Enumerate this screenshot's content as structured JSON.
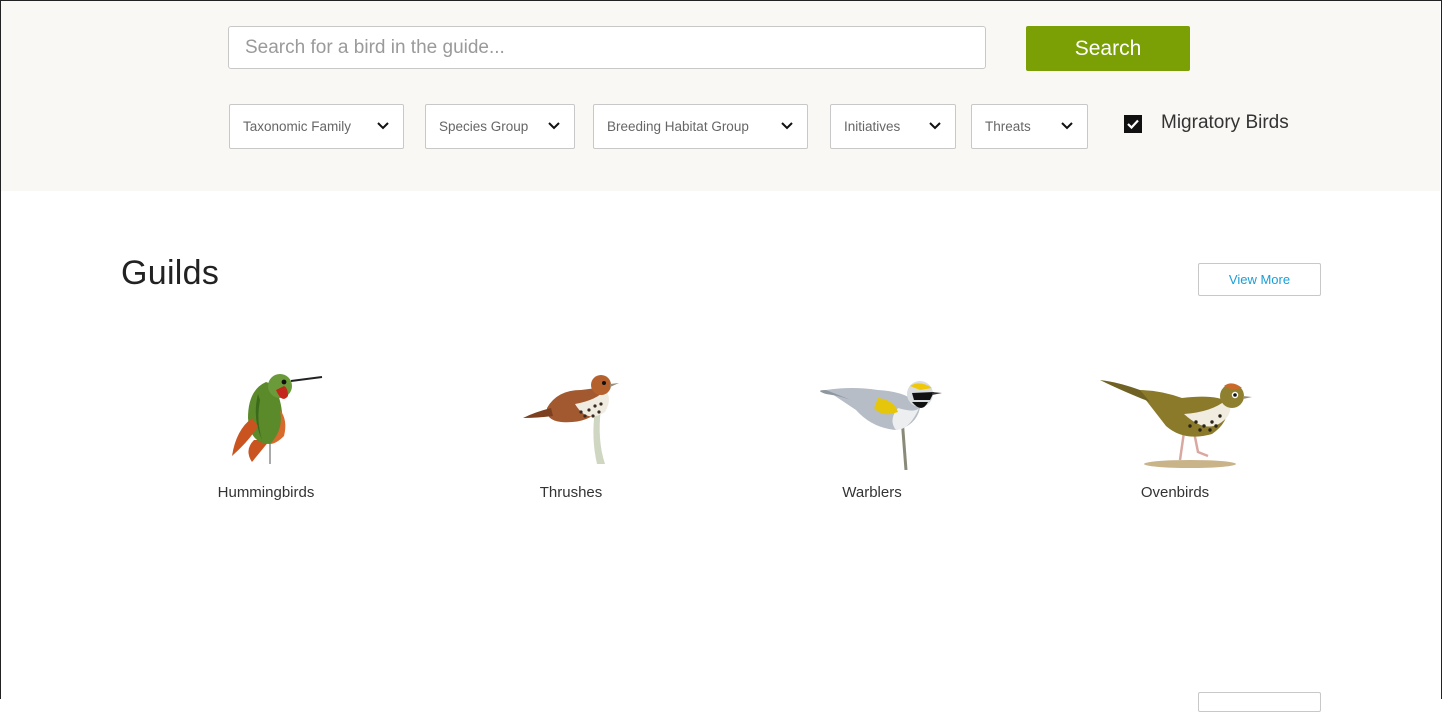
{
  "search": {
    "placeholder": "Search for a bird in the guide...",
    "button_label": "Search"
  },
  "filters": [
    {
      "label": "Taxonomic Family"
    },
    {
      "label": "Species Group"
    },
    {
      "label": "Breeding Habitat Group"
    },
    {
      "label": "Initiatives"
    },
    {
      "label": "Threats"
    }
  ],
  "migratory": {
    "label": "Migratory Birds",
    "checked": true
  },
  "guilds": {
    "title": "Guilds",
    "view_more_label": "View More",
    "items": [
      {
        "name": "Hummingbirds",
        "icon": "hummingbird-icon"
      },
      {
        "name": "Thrushes",
        "icon": "thrush-icon"
      },
      {
        "name": "Warblers",
        "icon": "warbler-icon"
      },
      {
        "name": "Ovenbirds",
        "icon": "ovenbird-icon"
      }
    ]
  },
  "colors": {
    "accent": "#7aa006",
    "link": "#1a9ed6",
    "topbar_bg": "#f9f8f4"
  }
}
